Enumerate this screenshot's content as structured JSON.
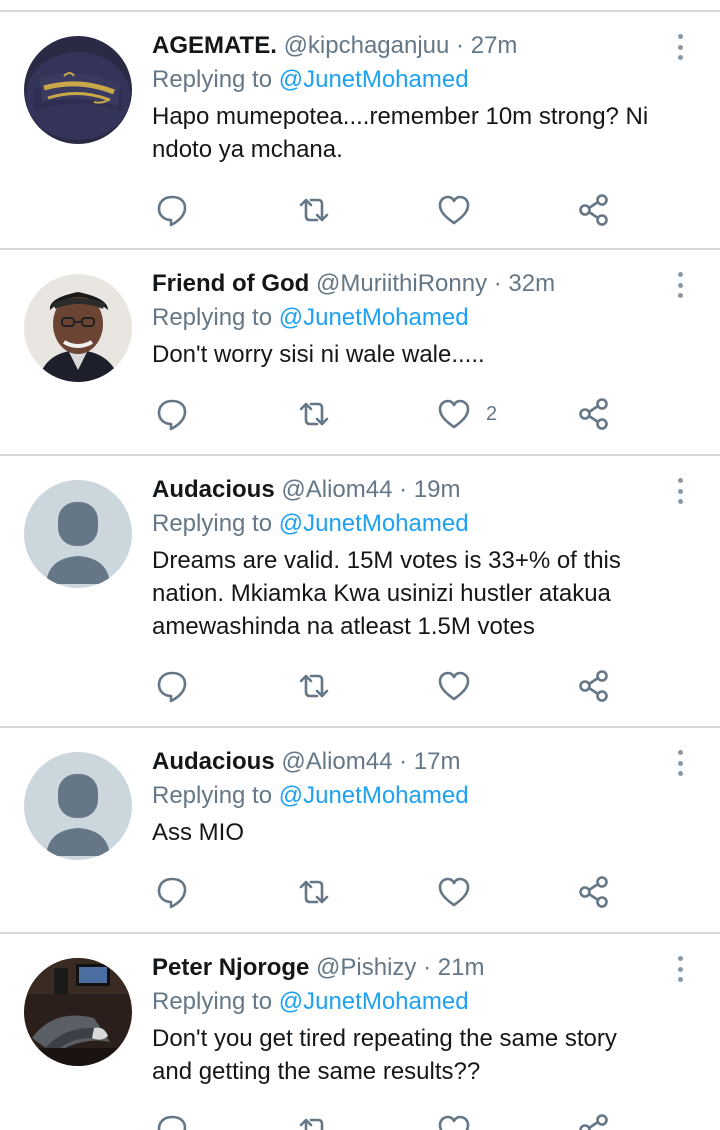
{
  "colors": {
    "link": "#1da1f2",
    "secondary": "#657786",
    "divider": "#d6d9dc",
    "icon": "#657786"
  },
  "tweets": [
    {
      "name": "AGEMATE.",
      "handle": "@kipchaganjuu",
      "separator": "·",
      "time": "27m",
      "replying_prefix": "Replying to",
      "replying_to": "@JunetMohamed",
      "text": "Hapo mumepotea....remember 10m strong? Ni ndoto ya mchana.",
      "likes": "",
      "avatar": "hustlers-cap-avatar"
    },
    {
      "name": "Friend of God",
      "handle": "@MuriithiRonny",
      "separator": "·",
      "time": "32m",
      "replying_prefix": "Replying to",
      "replying_to": "@JunetMohamed",
      "text": "Don't worry sisi ni wale wale.....",
      "likes": "2",
      "avatar": "elderly-man-avatar"
    },
    {
      "name": "Audacious",
      "handle": "@Aliom44",
      "separator": "·",
      "time": "19m",
      "replying_prefix": "Replying to",
      "replying_to": "@JunetMohamed",
      "text": "Dreams are valid. 15M votes is 33+% of this nation. Mkiamka Kwa usinizi hustler atakua amewashinda na atleast 1.5M votes",
      "likes": "",
      "avatar": "default-avatar"
    },
    {
      "name": "Audacious",
      "handle": "@Aliom44",
      "separator": "·",
      "time": "17m",
      "replying_prefix": "Replying to",
      "replying_to": "@JunetMohamed",
      "text": "Ass MIO",
      "likes": "",
      "avatar": "default-avatar"
    },
    {
      "name": "Peter Njoroge",
      "handle": "@Pishizy",
      "separator": "·",
      "time": "21m",
      "replying_prefix": "Replying to",
      "replying_to": "@JunetMohamed",
      "text": "Don't you get tired repeating the same story and getting the same results??",
      "likes": "",
      "avatar": "room-photo-avatar"
    }
  ]
}
